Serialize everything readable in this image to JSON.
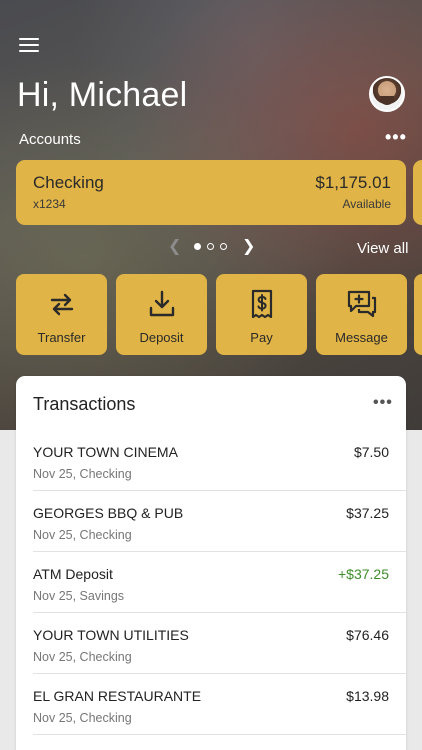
{
  "header": {
    "greeting": "Hi, Michael",
    "accounts_label": "Accounts",
    "more_label": "•••",
    "menu_icon": "hamburger-menu-icon",
    "avatar": "user-avatar"
  },
  "account": {
    "name": "Checking",
    "number": "x1234",
    "balance": "$1,175.01",
    "status": "Available"
  },
  "carousel": {
    "pages": 3,
    "active_page": 1,
    "view_all": "View all"
  },
  "actions": [
    {
      "label": "Transfer",
      "icon": "transfer-arrows-icon"
    },
    {
      "label": "Deposit",
      "icon": "download-tray-icon"
    },
    {
      "label": "Pay",
      "icon": "dollar-bill-icon"
    },
    {
      "label": "Message",
      "icon": "chat-plus-icon"
    }
  ],
  "transactions": {
    "title": "Transactions",
    "more_label": "•••",
    "items": [
      {
        "merchant": "YOUR TOWN CINEMA",
        "sub": "Nov 25, Checking",
        "amount": "$7.50",
        "credit": false
      },
      {
        "merchant": "GEORGES BBQ & PUB",
        "sub": "Nov 25, Checking",
        "amount": "$37.25",
        "credit": false
      },
      {
        "merchant": "ATM Deposit",
        "sub": "Nov 25, Savings",
        "amount": "+$37.25",
        "credit": true
      },
      {
        "merchant": "YOUR TOWN UTILITIES",
        "sub": "Nov 25, Checking",
        "amount": "$76.46",
        "credit": false
      },
      {
        "merchant": "EL GRAN RESTAURANTE",
        "sub": "Nov 25, Checking",
        "amount": "$13.98",
        "credit": false
      }
    ]
  },
  "colors": {
    "accent": "#e0b446",
    "credit": "#3e8e2a"
  }
}
